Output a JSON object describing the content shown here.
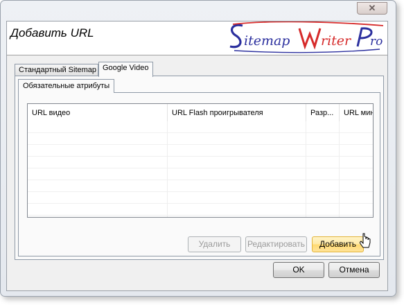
{
  "window": {
    "close_glyph": "✕"
  },
  "dialog": {
    "title": "Добавить URL",
    "logo_text": "SitemapWriterPro"
  },
  "tabs": [
    {
      "label": "Стандартный Sitemap",
      "active": false
    },
    {
      "label": "Google Video",
      "active": true
    }
  ],
  "subtabs": [
    {
      "label": "Обязательные атрибуты",
      "active": true
    }
  ],
  "grid": {
    "columns": [
      "URL видео",
      "URL Flash проигрывателя",
      "Разр...",
      "URL мин..."
    ],
    "row_count": 10
  },
  "panel_buttons": {
    "delete": "Удалить",
    "edit": "Редактировать",
    "add": "Добавить"
  },
  "dialog_buttons": {
    "ok": "OK",
    "cancel": "Отмена"
  },
  "colors": {
    "logo_blue": "#2b2f9e",
    "logo_red": "#d62a2a",
    "button_hover": "#ffe39a"
  }
}
